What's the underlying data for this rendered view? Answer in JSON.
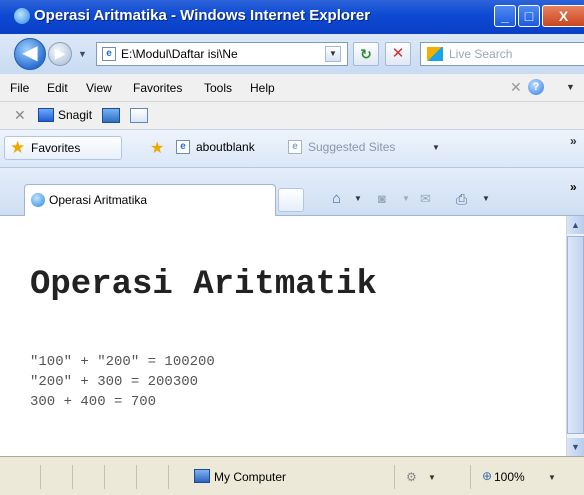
{
  "window": {
    "title": "Operasi Aritmatika - Windows Internet Explorer",
    "min_glyph": "_",
    "max_glyph": "□",
    "close_glyph": "X"
  },
  "address_bar": {
    "back_glyph": "◀",
    "forward_glyph": "▶",
    "url": "E:\\Modul\\Daftar isi\\Ne",
    "refresh_glyph": "↻",
    "stop_glyph": "✕",
    "search_placeholder": "Live Search"
  },
  "menu": {
    "items": [
      "File",
      "Edit",
      "View",
      "Favorites",
      "Tools",
      "Help"
    ]
  },
  "snagit": {
    "label": "Snagit"
  },
  "favorites_bar": {
    "favorites_label": "Favorites",
    "link_label": "aboutblank",
    "suggested_label": "Suggested Sites",
    "chevron": "»"
  },
  "tabs": [
    {
      "label": "Operasi Aritmatika"
    }
  ],
  "page": {
    "heading": "Operasi Aritmatik",
    "lines": [
      "\"100\" + \"200\" = 100200",
      "\"200\" + 300 = 200300",
      "300 + 400 = 700"
    ]
  },
  "status_bar": {
    "zone": "My Computer",
    "zoom": "100%"
  },
  "icons": {
    "ie_logo": "ie-logo-icon",
    "favorites_star": "star-icon",
    "home": "home-icon",
    "feeds": "rss-icon",
    "mail": "mail-icon",
    "print": "printer-icon",
    "help": "help-icon"
  }
}
